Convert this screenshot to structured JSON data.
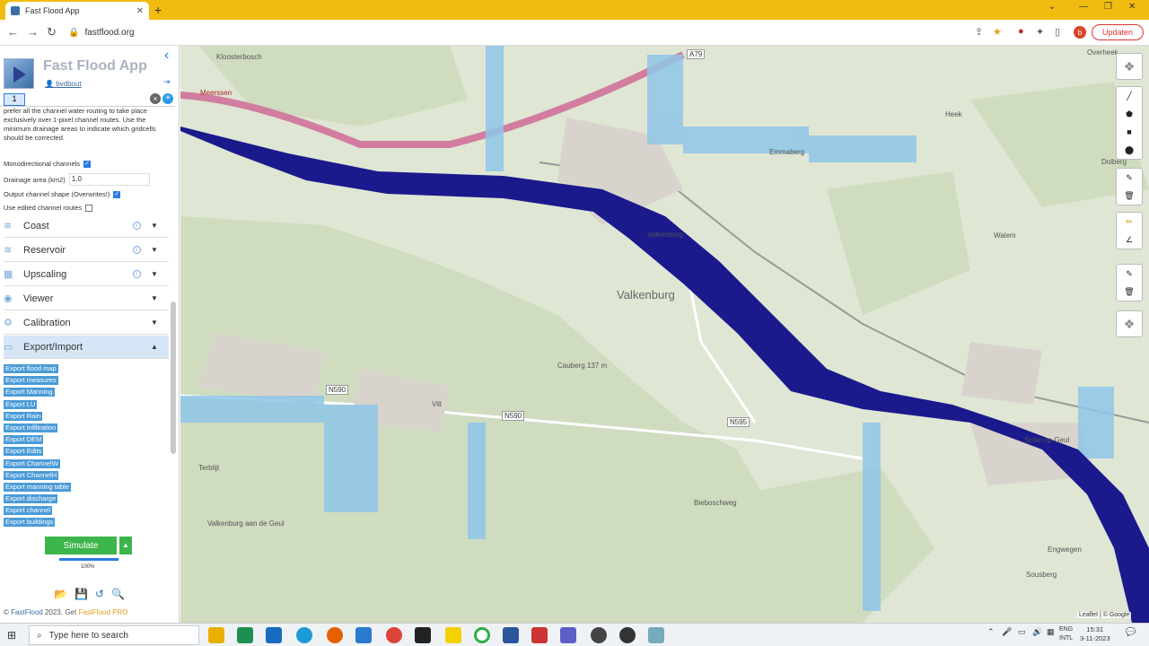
{
  "browser": {
    "tab_title": "Fast Flood App",
    "url": "fastflood.org",
    "profile_initial": "b",
    "update_label": "Updaten"
  },
  "app": {
    "title": "Fast Flood App",
    "user": "bvdbout",
    "number_value": "1",
    "description": "prefer all the channel water routing to take place exclusively over 1-pixel channel routes. Use the minimum drainage areas to indicate which gridcells should be corrected.",
    "options": {
      "mono_label": "Monodirectional channels",
      "drainage_label": "Drainage area (km2)",
      "drainage_value": "1.0",
      "output_label": "Output channel shape (Overwrites!)",
      "edited_label": "Use edited channel routes"
    },
    "sections": [
      {
        "label": "Coast",
        "icon": "waves-icon"
      },
      {
        "label": "Reservoir",
        "icon": "waves-icon"
      },
      {
        "label": "Upscaling",
        "icon": "grid-icon"
      },
      {
        "label": "Viewer",
        "icon": "eye-icon"
      },
      {
        "label": "Calibration",
        "icon": "gear-icon"
      },
      {
        "label": "Export/Import",
        "icon": "folder-icon"
      }
    ],
    "exports": [
      "Export flood map",
      "Export measures",
      "Export Manning",
      "Export LU",
      "Export Rain",
      "Export Infiltration",
      "Export DEM",
      "Export Edits",
      "Export ChannelW",
      "Export ChannelH",
      "Export manning table",
      "Export discharge",
      "Export channel",
      "Export buildings"
    ],
    "simulate_label": "Simulate",
    "progress_value": 100,
    "progress_text": "100%",
    "footer": {
      "prefix": "©",
      "brand": "FastFlood",
      "middle": "2023. Get",
      "pro": "FastFlood PRO"
    }
  },
  "map": {
    "labels": [
      {
        "text": "Kloosterbosch",
        "cls": ""
      },
      {
        "text": "Meerssen",
        "cls": ""
      },
      {
        "text": "Valkenburg",
        "cls": ""
      },
      {
        "text": "Heek",
        "cls": ""
      },
      {
        "text": "Emmaberg",
        "cls": ""
      },
      {
        "text": "Walem",
        "cls": ""
      },
      {
        "text": "Dolberg",
        "cls": ""
      },
      {
        "text": "Valkenburg",
        "cls": "big"
      },
      {
        "text": "Cauberg 137 m",
        "cls": ""
      },
      {
        "text": "Terblijt",
        "cls": ""
      },
      {
        "text": "Vilt",
        "cls": ""
      },
      {
        "text": "Schin op Geul",
        "cls": ""
      },
      {
        "text": "Valkenburg aan de Geul",
        "cls": ""
      },
      {
        "text": "Bieboschweg",
        "cls": ""
      },
      {
        "text": "Sousberg",
        "cls": ""
      },
      {
        "text": "Engwegen",
        "cls": ""
      },
      {
        "text": "Overheek",
        "cls": ""
      }
    ],
    "roads": [
      "N590",
      "N590",
      "N595",
      "A79"
    ],
    "attribution": "Leaflet | © Google"
  },
  "taskbar": {
    "search_placeholder": "Type here to search",
    "lang1": "ENG",
    "lang2": "INTL",
    "time": "15:31",
    "date": "3-11-2023"
  },
  "colors": {
    "flood_dark": "#1a1a8c",
    "flood_light": "#8fc6e8",
    "accent": "#2c7be5",
    "simulate": "#3cb54a",
    "tabbar": "#f1bc10"
  }
}
